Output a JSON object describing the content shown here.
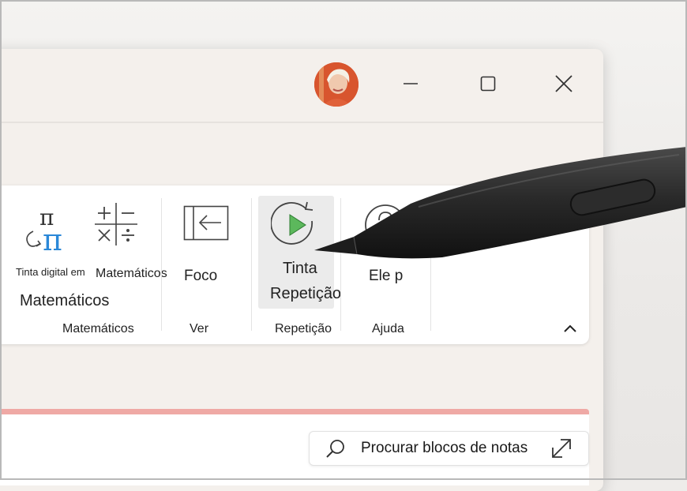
{
  "ribbon": {
    "math_group": {
      "ink_to_math_label_line1": "Tinta digital em",
      "ink_to_math_label_line2": "Matemáticos",
      "math_label": "Matemáticos",
      "group_label": "Matemáticos"
    },
    "view_group": {
      "focus_label": "Foco",
      "group_label": "Ver"
    },
    "replay_group": {
      "ink_replay_label_line1": "Tinta",
      "ink_replay_label_line2": "Repetição",
      "group_label": "Repetição"
    },
    "help_group": {
      "help_label": "Ele p",
      "group_label": "Ajuda"
    }
  },
  "search": {
    "placeholder": "Procurar blocos de notas"
  },
  "colors": {
    "accent_strip": "#efa9a5",
    "replay_play": "#5cb85c",
    "math_blue": "#2b88d8"
  }
}
